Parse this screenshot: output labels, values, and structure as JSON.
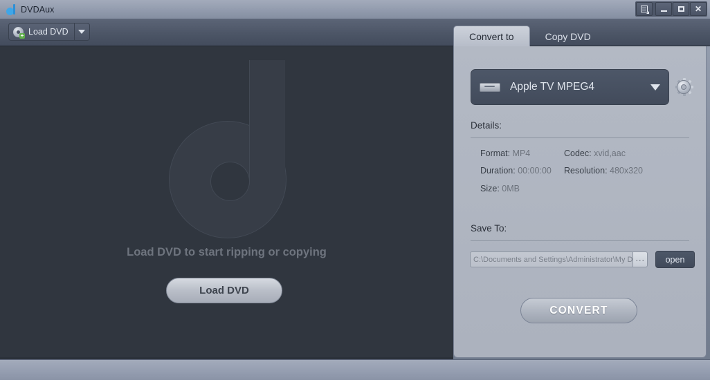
{
  "window": {
    "title": "DVDAux",
    "app_icon": "d-logo-icon",
    "controls": [
      {
        "name": "menu-button",
        "icon": "menu-icon",
        "glyph": ""
      },
      {
        "name": "minimize-button",
        "icon": "minimize-icon",
        "glyph": ""
      },
      {
        "name": "maximize-button",
        "icon": "maximize-icon",
        "glyph": ""
      },
      {
        "name": "close-button",
        "icon": "close-icon",
        "glyph": "✕"
      }
    ]
  },
  "toolbar": {
    "load_dvd_label": "Load DVD",
    "load_dvd_icon": "dvd-disc-add-icon",
    "dropdown_icon": "chevron-down-icon",
    "plus_glyph": "+"
  },
  "tabs": [
    {
      "label": "Convert to",
      "active": true
    },
    {
      "label": "Copy DVD",
      "active": false
    }
  ],
  "workspace": {
    "watermark_icon": "dvdaux-d-watermark",
    "hint": "Load DVD to start ripping or copying",
    "load_button_label": "Load  DVD"
  },
  "panel": {
    "device": {
      "name": "Apple TV MPEG4",
      "icon": "apple-tv-device-icon",
      "caret_icon": "chevron-down-icon",
      "settings_icon": "gear-icon"
    },
    "details": {
      "heading": "Details:",
      "fields": [
        {
          "key": "Format:",
          "value": "MP4"
        },
        {
          "key": "Codec:",
          "value": "xvid,aac"
        },
        {
          "key": "Duration:",
          "value": "00:00:00"
        },
        {
          "key": "Resolution:",
          "value": "480x320"
        },
        {
          "key": "Size:",
          "value": "0MB"
        }
      ]
    },
    "save_to": {
      "heading": "Save To:",
      "path_value": "C:\\Documents and Settings\\Administrator\\My D",
      "browse_label": "···",
      "open_label": "open"
    },
    "convert_label": "CONVERT"
  },
  "colors": {
    "accent_dark": "#434c5d",
    "panel_bg": "#b0b6c1",
    "workspace_bg": "#30363f",
    "titlebar": "#959eb0",
    "text_light": "#e2e7ef",
    "text_dark": "#2c313a",
    "muted": "#6d737d"
  }
}
